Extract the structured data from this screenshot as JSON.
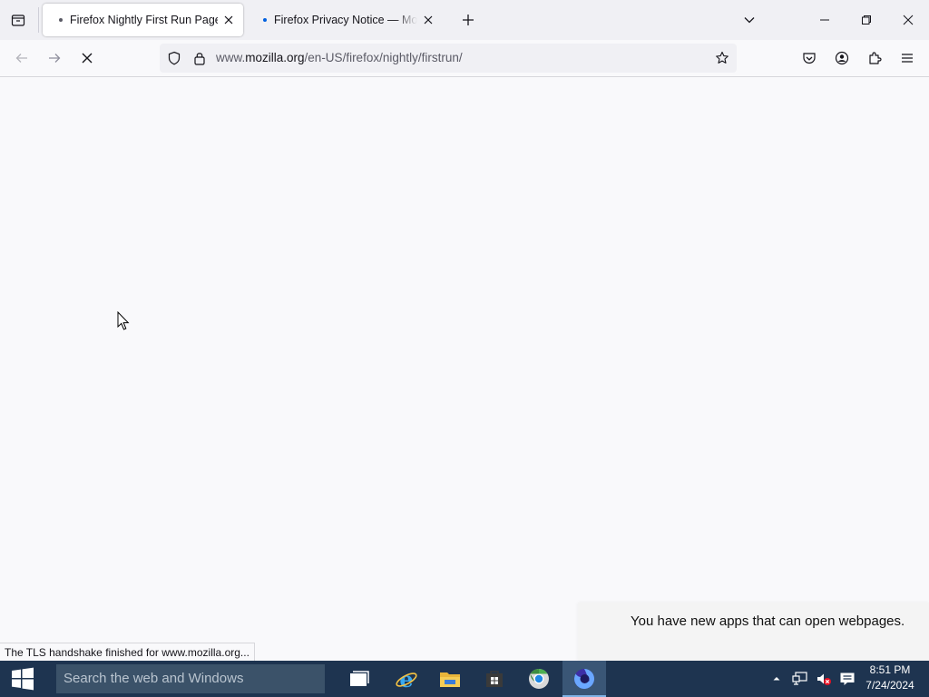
{
  "tabs": [
    {
      "title": "Firefox Nightly First Run Page",
      "dot_color": "#5b5b66"
    },
    {
      "title": "Firefox Privacy Notice — Mozilla",
      "dot_color": "#0060df"
    }
  ],
  "url": {
    "prefix": "www.",
    "host": "mozilla.org",
    "path": "/en-US/firefox/nightly/firstrun/"
  },
  "status_text": "The TLS handshake finished for www.mozilla.org...",
  "notification": "You have new apps that can open webpages.",
  "taskbar": {
    "search_placeholder": "Search the web and Windows",
    "apps": [
      "task-view",
      "internet-explorer",
      "file-explorer",
      "store",
      "chrome",
      "firefox-nightly"
    ],
    "time": "8:51 PM",
    "date": "7/24/2024"
  },
  "icons": {
    "tab_list": "tab-list-icon",
    "close_tab": "close-icon",
    "new_tab": "plus-icon",
    "list_all_tabs": "chevron-down-icon",
    "back": "back-arrow-icon",
    "forward": "forward-arrow-icon",
    "stop": "stop-icon",
    "tracking_protection": "shield-icon",
    "lock": "lock-icon",
    "bookmark": "star-icon",
    "pocket": "pocket-icon",
    "account": "account-icon",
    "extensions": "puzzle-icon",
    "menu": "hamburger-icon"
  },
  "colors": {
    "accent": "#0060df",
    "taskbar": "#1e3450",
    "active_app": "#3a5676"
  }
}
